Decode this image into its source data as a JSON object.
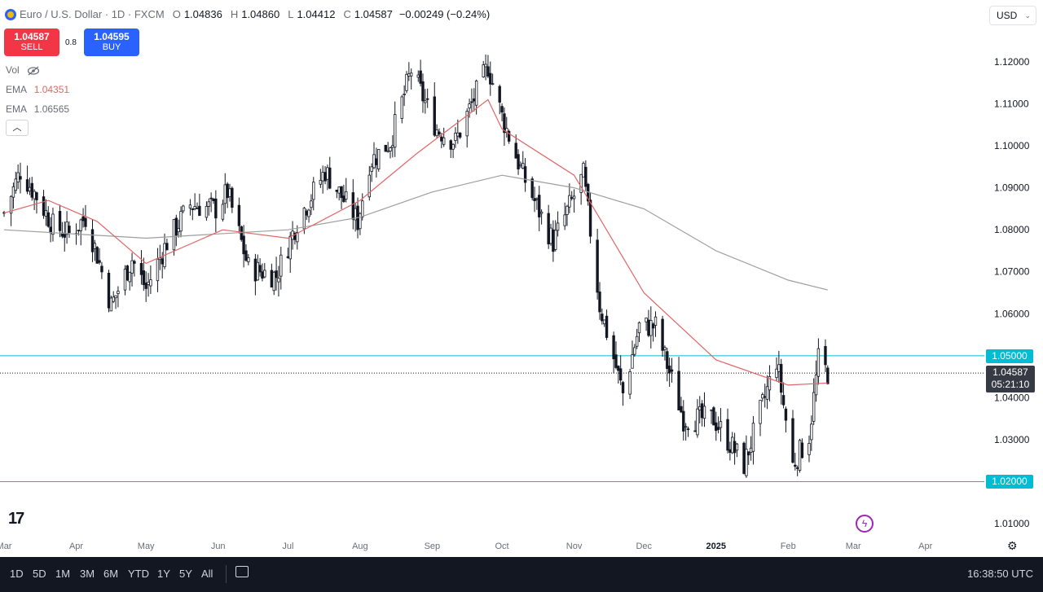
{
  "header": {
    "symbol": "Euro / U.S. Dollar · 1D · FXCM",
    "open_label": "O",
    "open": "1.04836",
    "high_label": "H",
    "high": "1.04860",
    "low_label": "L",
    "low": "1.04412",
    "close_label": "C",
    "close": "1.04587",
    "change": "−0.00249 (−0.24%)"
  },
  "trade": {
    "sell_price": "1.04587",
    "sell_label": "SELL",
    "spread": "0.8",
    "buy_price": "1.04595",
    "buy_label": "BUY"
  },
  "indicators": {
    "vol_label": "Vol",
    "ema1_label": "EMA",
    "ema1_value": "1.04351",
    "ema1_color": "#e06666",
    "ema2_label": "EMA",
    "ema2_value": "1.06565",
    "ema2_color": "#9e9e9e"
  },
  "currency": "USD",
  "price_tags": {
    "upper_level": "1.05000",
    "last_price": "1.04587",
    "countdown": "05:21:10",
    "lower_level": "1.02000"
  },
  "bottom_bar": {
    "ranges": [
      "1D",
      "5D",
      "1M",
      "3M",
      "6M",
      "YTD",
      "1Y",
      "5Y",
      "All"
    ],
    "clock": "16:38:50 UTC"
  },
  "colors": {
    "candle": "#131722",
    "level_line": "#00bcd4",
    "accent": "#2962ff",
    "sell": "#f23645"
  },
  "chart_data": {
    "type": "candlestick",
    "y_axis": {
      "min": 1.005,
      "max": 1.125,
      "ticks": [
        "1.12000",
        "1.11000",
        "1.10000",
        "1.09000",
        "1.08000",
        "1.07000",
        "1.06000",
        "1.05000",
        "1.04000",
        "1.03000",
        "1.02000",
        "1.01000"
      ]
    },
    "x_axis": {
      "start": "2024-03-01",
      "end": "2025-04-20",
      "months": [
        {
          "label": "Mar",
          "date": "2024-03-01"
        },
        {
          "label": "Apr",
          "date": "2024-04-01"
        },
        {
          "label": "May",
          "date": "2024-05-01"
        },
        {
          "label": "Jun",
          "date": "2024-06-01"
        },
        {
          "label": "Jul",
          "date": "2024-07-01"
        },
        {
          "label": "Aug",
          "date": "2024-08-01"
        },
        {
          "label": "Sep",
          "date": "2024-09-01"
        },
        {
          "label": "Oct",
          "date": "2024-10-01"
        },
        {
          "label": "Nov",
          "date": "2024-11-01"
        },
        {
          "label": "Dec",
          "date": "2024-12-01"
        },
        {
          "label": "2025",
          "date": "2025-01-01"
        },
        {
          "label": "Feb",
          "date": "2025-02-01"
        },
        {
          "label": "Mar",
          "date": "2025-03-01"
        },
        {
          "label": "Apr",
          "date": "2025-04-01"
        }
      ]
    },
    "horizontal_levels": [
      1.05,
      1.02
    ],
    "last_price": 1.04587,
    "close_path": [
      {
        "date": "2024-03-01",
        "close": 1.084
      },
      {
        "date": "2024-03-08",
        "close": 1.094
      },
      {
        "date": "2024-03-15",
        "close": 1.088
      },
      {
        "date": "2024-03-22",
        "close": 1.081
      },
      {
        "date": "2024-03-29",
        "close": 1.079
      },
      {
        "date": "2024-04-05",
        "close": 1.083
      },
      {
        "date": "2024-04-10",
        "close": 1.074
      },
      {
        "date": "2024-04-16",
        "close": 1.062
      },
      {
        "date": "2024-04-25",
        "close": 1.073
      },
      {
        "date": "2024-05-01",
        "close": 1.066
      },
      {
        "date": "2024-05-10",
        "close": 1.077
      },
      {
        "date": "2024-05-20",
        "close": 1.086
      },
      {
        "date": "2024-05-31",
        "close": 1.085
      },
      {
        "date": "2024-06-05",
        "close": 1.089
      },
      {
        "date": "2024-06-14",
        "close": 1.071
      },
      {
        "date": "2024-06-26",
        "close": 1.069
      },
      {
        "date": "2024-07-05",
        "close": 1.082
      },
      {
        "date": "2024-07-17",
        "close": 1.094
      },
      {
        "date": "2024-07-31",
        "close": 1.082
      },
      {
        "date": "2024-08-05",
        "close": 1.096
      },
      {
        "date": "2024-08-14",
        "close": 1.101
      },
      {
        "date": "2024-08-23",
        "close": 1.118
      },
      {
        "date": "2024-09-03",
        "close": 1.104
      },
      {
        "date": "2024-09-11",
        "close": 1.101
      },
      {
        "date": "2024-09-25",
        "close": 1.119
      },
      {
        "date": "2024-10-01",
        "close": 1.107
      },
      {
        "date": "2024-10-10",
        "close": 1.093
      },
      {
        "date": "2024-10-23",
        "close": 1.077
      },
      {
        "date": "2024-11-05",
        "close": 1.093
      },
      {
        "date": "2024-11-12",
        "close": 1.062
      },
      {
        "date": "2024-11-22",
        "close": 1.041
      },
      {
        "date": "2024-11-29",
        "close": 1.057
      },
      {
        "date": "2024-12-06",
        "close": 1.057
      },
      {
        "date": "2024-12-18",
        "close": 1.035
      },
      {
        "date": "2024-12-31",
        "close": 1.035
      },
      {
        "date": "2025-01-13",
        "close": 1.024
      },
      {
        "date": "2025-01-27",
        "close": 1.049
      },
      {
        "date": "2025-02-03",
        "close": 1.024
      },
      {
        "date": "2025-02-10",
        "close": 1.031
      },
      {
        "date": "2025-02-14",
        "close": 1.049
      },
      {
        "date": "2025-02-18",
        "close": 1.04587
      }
    ],
    "ema_fast": [
      {
        "date": "2024-03-01",
        "value": 1.084
      },
      {
        "date": "2024-03-20",
        "value": 1.087
      },
      {
        "date": "2024-04-10",
        "value": 1.082
      },
      {
        "date": "2024-05-01",
        "value": 1.072
      },
      {
        "date": "2024-06-03",
        "value": 1.08
      },
      {
        "date": "2024-07-01",
        "value": 1.078
      },
      {
        "date": "2024-08-01",
        "value": 1.087
      },
      {
        "date": "2024-08-25",
        "value": 1.098
      },
      {
        "date": "2024-09-25",
        "value": 1.111
      },
      {
        "date": "2024-10-01",
        "value": 1.104
      },
      {
        "date": "2024-11-01",
        "value": 1.093
      },
      {
        "date": "2024-12-01",
        "value": 1.065
      },
      {
        "date": "2025-01-01",
        "value": 1.049
      },
      {
        "date": "2025-02-01",
        "value": 1.043
      },
      {
        "date": "2025-02-18",
        "value": 1.04351
      }
    ],
    "ema_slow": [
      {
        "date": "2024-03-01",
        "value": 1.08
      },
      {
        "date": "2024-05-01",
        "value": 1.078
      },
      {
        "date": "2024-07-01",
        "value": 1.08
      },
      {
        "date": "2024-08-01",
        "value": 1.083
      },
      {
        "date": "2024-09-01",
        "value": 1.089
      },
      {
        "date": "2024-10-01",
        "value": 1.093
      },
      {
        "date": "2024-11-01",
        "value": 1.09
      },
      {
        "date": "2024-12-01",
        "value": 1.085
      },
      {
        "date": "2025-01-01",
        "value": 1.075
      },
      {
        "date": "2025-02-01",
        "value": 1.068
      },
      {
        "date": "2025-02-18",
        "value": 1.06565
      }
    ]
  }
}
